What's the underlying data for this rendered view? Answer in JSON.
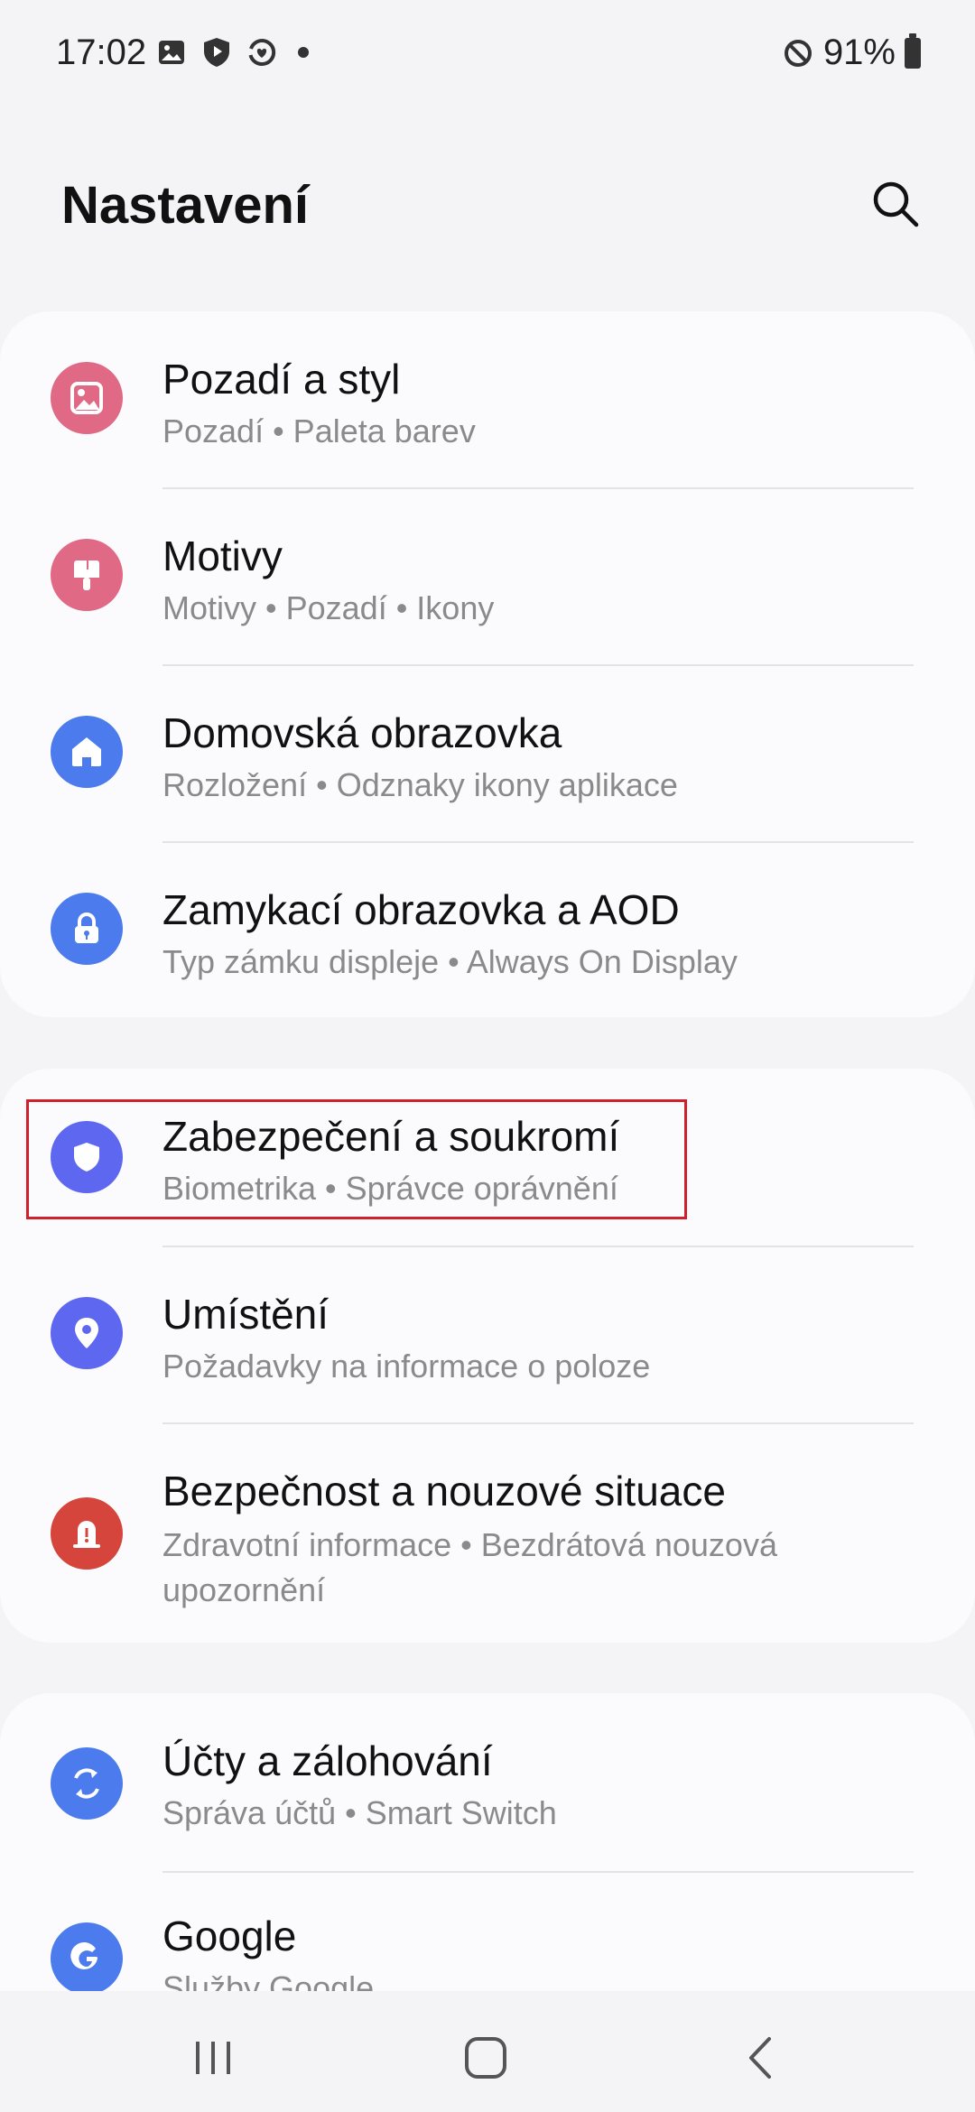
{
  "status_bar": {
    "time": "17:02",
    "icons_left": [
      "gallery-icon",
      "shield-play-icon",
      "sync-heart-icon",
      "notification-dot"
    ],
    "battery_percent": "91%",
    "icons_right": [
      "do-not-disturb-icon",
      "battery-icon"
    ]
  },
  "header": {
    "title": "Nastavení",
    "search_icon": "search-icon"
  },
  "colors": {
    "pink": "#e06a85",
    "blue": "#4b7bec",
    "indigo": "#5d67f0",
    "red": "#d5453b",
    "highlight": "#d0202c"
  },
  "groups": [
    {
      "items": [
        {
          "title": "Pozadí a styl",
          "subtitle": "Pozadí  •  Paleta barev",
          "icon": "wallpaper-icon"
        },
        {
          "title": "Motivy",
          "subtitle": "Motivy  •  Pozadí  •  Ikony",
          "icon": "paintbrush-icon"
        },
        {
          "title": "Domovská obrazovka",
          "subtitle": "Rozložení  •  Odznaky ikony aplikace",
          "icon": "home-icon"
        },
        {
          "title": "Zamykací obrazovka a AOD",
          "subtitle": "Typ zámku displeje  •  Always On Display",
          "icon": "lock-icon"
        }
      ]
    },
    {
      "items": [
        {
          "title": "Zabezpečení a soukromí",
          "subtitle": "Biometrika  •  Správce oprávnění",
          "icon": "shield-icon"
        },
        {
          "title": "Umístění",
          "subtitle": "Požadavky na informace o poloze",
          "icon": "location-pin-icon"
        },
        {
          "title": "Bezpečnost a nouzové situace",
          "subtitle": "Zdravotní informace  •  Bezdrátová nouzová upozornění",
          "icon": "emergency-icon"
        }
      ]
    },
    {
      "items": [
        {
          "title": "Účty a zálohování",
          "subtitle": "Správa účtů  •  Smart Switch",
          "icon": "sync-icon"
        },
        {
          "title": "Google",
          "subtitle": "Služby Google",
          "icon": "google-icon"
        }
      ]
    }
  ],
  "nav_bar": {
    "recents": "recents-icon",
    "home": "home-nav-icon",
    "back": "back-icon"
  }
}
